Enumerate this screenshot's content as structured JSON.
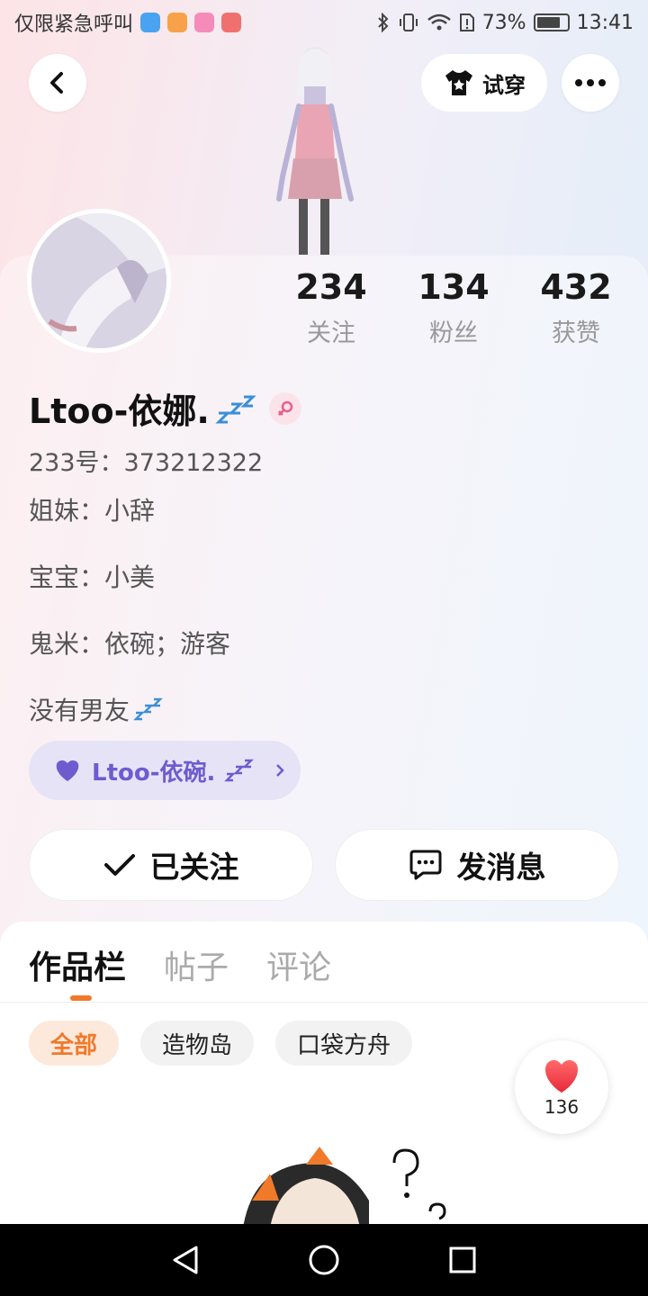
{
  "status_bar": {
    "carrier_text": "仅限紧急呼叫",
    "battery": "73%",
    "time": "13:41"
  },
  "header": {
    "try_on_label": "试穿"
  },
  "stats": [
    {
      "value": "234",
      "label": "关注"
    },
    {
      "value": "134",
      "label": "粉丝"
    },
    {
      "value": "432",
      "label": "获赞"
    }
  ],
  "profile": {
    "username": "Ltoo-依娜.",
    "uid": "233号：373212322",
    "bio": [
      "姐妹：小辞",
      "宝宝：小美",
      "鬼米：依碗；游客",
      "没有男友"
    ],
    "fan_badge": "Ltoo-依碗."
  },
  "actions": {
    "followed_label": "已关注",
    "message_label": "发消息"
  },
  "tabs": [
    "作品栏",
    "帖子",
    "评论"
  ],
  "filter_chips": [
    "全部",
    "造物岛",
    "口袋方舟"
  ],
  "likes": {
    "count": "136"
  },
  "colors": {
    "accent": "#f07a2a",
    "badge_text": "#6f5bd0",
    "badge_bg": "#e7e3f7"
  }
}
